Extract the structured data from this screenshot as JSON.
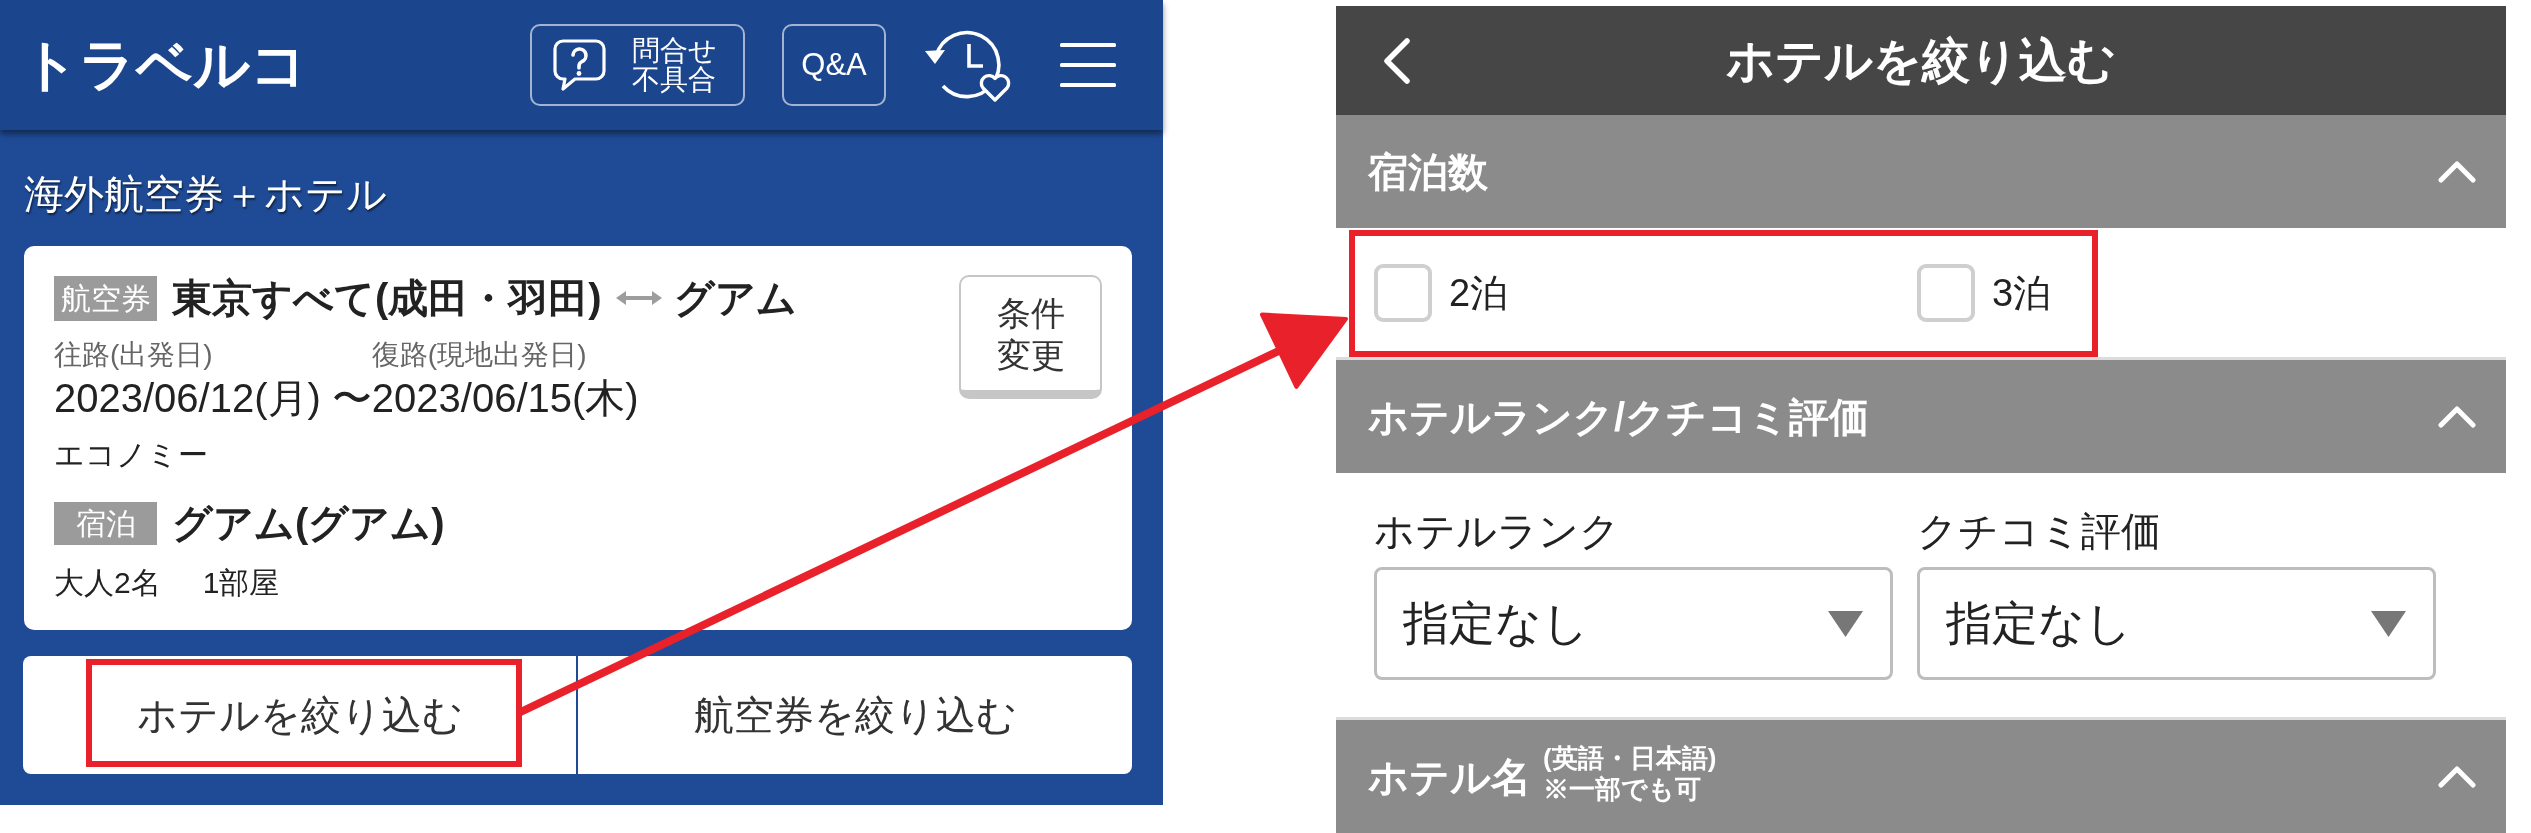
{
  "left_screen": {
    "header": {
      "logo": "トラベルコ",
      "inquiry_button": {
        "lines": [
          "問合せ",
          "不具合"
        ]
      },
      "qa_button": {
        "label": "Q&A"
      }
    },
    "page_heading": "海外航空券＋ホテル",
    "summary_card": {
      "flight": {
        "tag": "航空券",
        "origin": "東京すべて(成田・羽田)",
        "destination": "グアム",
        "outbound_label": "往路(出発日)",
        "return_label": "復路(現地出発日)",
        "outbound_date": "2023/06/12(月)",
        "separator": "〜",
        "return_date": "2023/06/15(木)",
        "cabin": "エコノミー"
      },
      "stay": {
        "tag": "宿泊",
        "location": "グアム(グアム)",
        "guests": "大人2名",
        "rooms": "1部屋"
      },
      "change_button": {
        "lines": [
          "条件",
          "変更"
        ]
      }
    },
    "filter_buttons": [
      {
        "label": "ホテルを絞り込む",
        "highlighted": true
      },
      {
        "label": "航空券を絞り込む",
        "highlighted": false
      }
    ]
  },
  "right_screen": {
    "title": "ホテルを絞り込む",
    "sections": [
      {
        "kind": "checkboxes",
        "title": "宿泊数",
        "expanded": true,
        "highlighted": true,
        "options": [
          {
            "label": "2泊",
            "checked": false
          },
          {
            "label": "3泊",
            "checked": false
          }
        ]
      },
      {
        "kind": "dropdowns",
        "title": "ホテルランク/クチコミ評価",
        "expanded": true,
        "fields": [
          {
            "label": "ホテルランク",
            "value": "指定なし"
          },
          {
            "label": "クチコミ評価",
            "value": "指定なし"
          }
        ]
      },
      {
        "kind": "title_only",
        "title": "ホテル名",
        "note_lines": [
          "(英語・日本語)",
          "※一部でも可"
        ],
        "expanded": true
      }
    ]
  }
}
